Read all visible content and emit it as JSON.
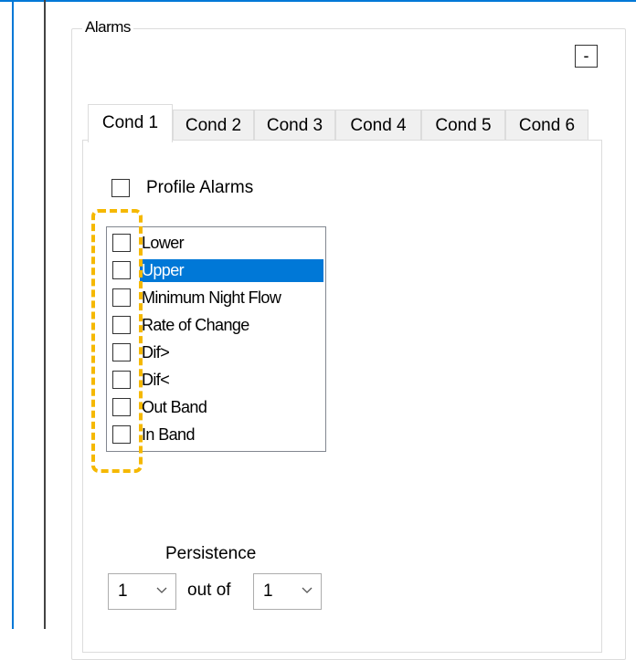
{
  "group": {
    "title": "Alarms",
    "collapse_label": "-"
  },
  "tabs": [
    {
      "label": "Cond 1",
      "active": true
    },
    {
      "label": "Cond 2",
      "active": false
    },
    {
      "label": "Cond 3",
      "active": false
    },
    {
      "label": "Cond 4",
      "active": false
    },
    {
      "label": "Cond 5",
      "active": false
    },
    {
      "label": "Cond 6",
      "active": false
    }
  ],
  "profile_alarms": {
    "label": "Profile Alarms",
    "checked": false
  },
  "alarm_list": [
    {
      "label": "Lower",
      "checked": false,
      "selected": false
    },
    {
      "label": "Upper",
      "checked": false,
      "selected": true
    },
    {
      "label": "Minimum Night Flow",
      "checked": false,
      "selected": false
    },
    {
      "label": "Rate of Change",
      "checked": false,
      "selected": false
    },
    {
      "label": "Dif>",
      "checked": false,
      "selected": false
    },
    {
      "label": "Dif<",
      "checked": false,
      "selected": false
    },
    {
      "label": "Out Band",
      "checked": false,
      "selected": false
    },
    {
      "label": "In Band",
      "checked": false,
      "selected": false
    }
  ],
  "persistence": {
    "label": "Persistence",
    "count_value": "1",
    "out_of_label": "out of",
    "total_value": "1"
  },
  "colors": {
    "accent": "#0078d7",
    "highlight": "#f5b800"
  }
}
